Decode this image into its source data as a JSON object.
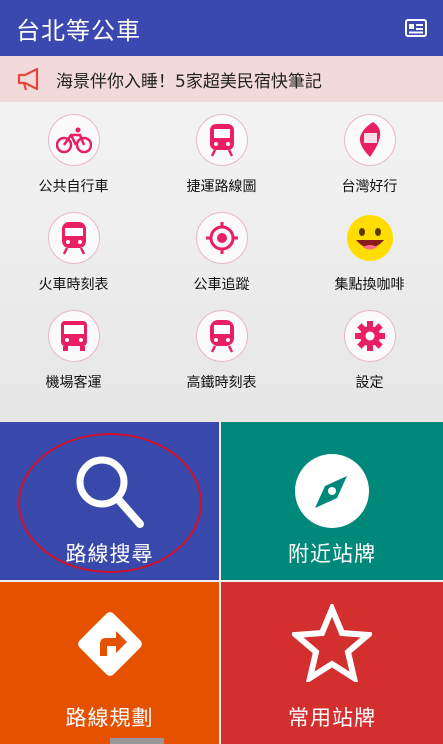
{
  "appbar": {
    "title": "台北等公車",
    "menu_icon": "news-icon"
  },
  "banner": {
    "text": "海景伴你入睡！5家超美民宿快筆記",
    "icon": "megaphone-icon"
  },
  "grid": [
    {
      "label": "公共自行車",
      "icon": "bicycle-icon"
    },
    {
      "label": "捷運路線圖",
      "icon": "metro-icon"
    },
    {
      "label": "台灣好行",
      "icon": "taiwan-map-icon"
    },
    {
      "label": "火車時刻表",
      "icon": "train-icon"
    },
    {
      "label": "公車追蹤",
      "icon": "target-icon"
    },
    {
      "label": "集點換咖啡",
      "icon": "smiley-icon"
    },
    {
      "label": "機場客運",
      "icon": "bus-icon"
    },
    {
      "label": "高鐵時刻表",
      "icon": "hsr-icon"
    },
    {
      "label": "設定",
      "icon": "gear-icon"
    }
  ],
  "tiles": [
    {
      "label": "路線搜尋",
      "icon": "search-icon",
      "color": "#3949ab"
    },
    {
      "label": "附近站牌",
      "icon": "compass-icon",
      "color": "#00897b"
    },
    {
      "label": "路線規劃",
      "icon": "route-sign-icon",
      "color": "#e65100"
    },
    {
      "label": "常用站牌",
      "icon": "star-icon",
      "color": "#d32f2f"
    }
  ],
  "colors": {
    "accent": "#e91e63",
    "appbar": "#3a48b0"
  }
}
